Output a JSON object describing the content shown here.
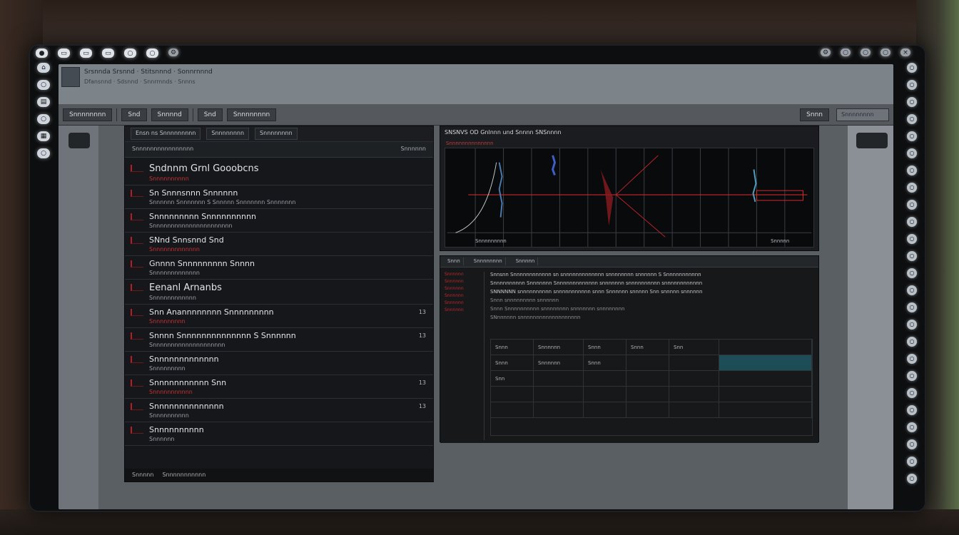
{
  "window": {
    "title": "Srsnnda Srsnnd · Stitsnnnd · Sonnrnnnd",
    "subtitle": "Dfansnnd · Sdsnnd · Snnrmnds · Snnns",
    "toolbar_buttons": [
      "Snnnnnnnn",
      "Snd",
      "Snnnnd",
      "Snd",
      "Snnnnnnnn"
    ],
    "toolbar_right_label": "Snnn",
    "search_placeholder": "Snnnnnnnn"
  },
  "left_panel": {
    "tabs": [
      "Ensn ns Snnnnnnnnn",
      "Snnnnnnnn",
      "Snnnnnnnn"
    ],
    "sub_left": "Snnnnnnnnnnnnnnnn",
    "sub_right": "Snnnnnn",
    "items": [
      {
        "head": "Sndnnm Grnl Gooobcns",
        "sub": "Snnnnnnnnnn",
        "big": true,
        "num": ""
      },
      {
        "head": "Sn Snnnsnnn Snnnnnn",
        "sub": "Snnnnnn Snnnnnnn S Snnnnn Snnnnnnn Snnnnnnn",
        "big": false,
        "num": ""
      },
      {
        "head": "Snnnnnnnnn Snnnnnnnnnn",
        "sub": "Snnnnnnnnnnnnnnnnnnnnnn",
        "big": false,
        "num": ""
      },
      {
        "head": "SNnd Snnsnnd Snd",
        "sub": "Snnnnnnnnnnnnn",
        "big": false,
        "num": ""
      },
      {
        "head": "Gnnnn Snnnnnnnnn Snnnn",
        "sub": "Snnnnnnnnnnnnn",
        "big": false,
        "num": ""
      },
      {
        "head": "Eenanl Arnanbs",
        "sub": "Snnnnnnnnnnnn",
        "big": true,
        "num": ""
      },
      {
        "head": "Snn Anannnnnnnn Snnnnnnnnn",
        "sub": "Snnnnnnnnn",
        "big": false,
        "num": "13"
      },
      {
        "head": "Snnnn Snnnnnnnnnnnnnn S Snnnnnn",
        "sub": "Snnnnnnnnnnnnnnnnnnnn",
        "big": false,
        "num": "13"
      },
      {
        "head": "Snnnnnnnnnnnnn",
        "sub": "Snnnnnnnnn",
        "big": false,
        "num": ""
      },
      {
        "head": "Snnnnnnnnnnn Snn",
        "sub": "Snnnnnnnnnnn",
        "big": false,
        "num": "13"
      },
      {
        "head": "Snnnnnnnnnnnnnn",
        "sub": "Snnnnnnnnnn",
        "big": false,
        "num": "13"
      },
      {
        "head": "Snnnnnnnnnn",
        "sub": "Snnnnnn",
        "big": false,
        "num": ""
      }
    ],
    "footer": [
      "Snnnnn",
      "Snnnnnnnnnnn"
    ]
  },
  "plot_panel": {
    "title": "SNSNVS OD Gnlnnn und Snnnn SNSnnnn",
    "subtitle": "Snnnnnnnnnnnnnn",
    "x_left_label": "Snnnnnnnnn",
    "x_right_label": "Snnnnn"
  },
  "log_panel": {
    "tabs": [
      "Snnn",
      "Snnnnnnnn",
      "Snnnnn"
    ],
    "tags": [
      "Snnnnnn",
      "Snnnnnn",
      "Snnnnnn",
      "Snnnnnn",
      "Snnnnnn",
      "Snnnnnn"
    ],
    "lines": [
      "Snnsnn Snnnnnnnnnnnn sn snnnnnnnnnnnnn snnnnnnnn snnnnnn S Snnnnnnnnnnn",
      "Snnnnnnnnnn Snnnnnnn Snnnnnnnnnnnnn snnnnnnn snnnnnnnnnn snnnnnnnnnnnn",
      "SNNNNNN snnnnnnnnnn snnnnnnnnnnn snnn Snnnnnn snnnnn Snn snnnnn snnnnnn",
      "Snnn snnnnnnnnn snnnnnn",
      "Snnn Snnnnnnnnnn snnnnnnnn snnnnnnn snnnnnnnn",
      "SNnnnnnn snnnnnnnnnnnnnnnnnnn"
    ],
    "table_rows": [
      [
        "Snnn",
        "Snnnnnn",
        "Snnn",
        "Snnn",
        "Snn",
        ""
      ],
      [
        "Snnn",
        "Snnnnnn",
        "Snnn",
        "",
        "",
        ""
      ],
      [
        "Snn",
        "",
        "",
        "",
        "",
        ""
      ],
      [
        "",
        "",
        "",
        "",
        "",
        ""
      ],
      [
        "",
        "",
        "",
        "",
        "",
        ""
      ]
    ]
  }
}
